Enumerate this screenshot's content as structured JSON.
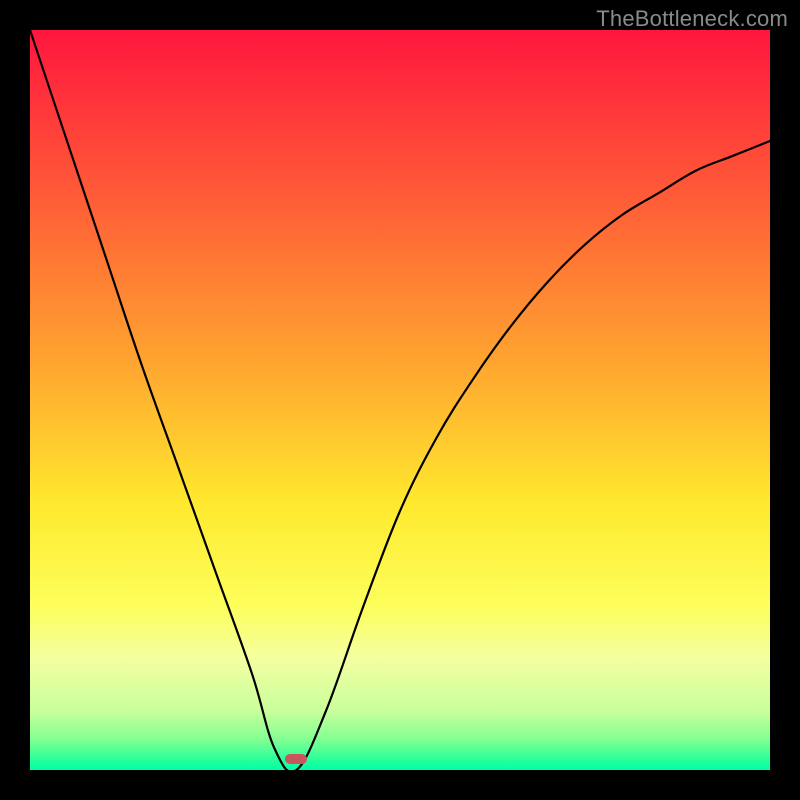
{
  "watermark": "TheBottleneck.com",
  "chart_data": {
    "type": "line",
    "title": "",
    "xlabel": "",
    "ylabel": "",
    "xlim": [
      0,
      100
    ],
    "ylim": [
      0,
      100
    ],
    "grid": false,
    "legend": false,
    "series": [
      {
        "name": "bottleneck-curve",
        "x": [
          0,
          5,
          10,
          15,
          20,
          25,
          30,
          33,
          36,
          40,
          45,
          50,
          55,
          60,
          65,
          70,
          75,
          80,
          85,
          90,
          95,
          100
        ],
        "values": [
          100,
          85,
          70,
          55,
          41,
          27,
          13,
          3,
          0,
          8,
          22,
          35,
          45,
          53,
          60,
          66,
          71,
          75,
          78,
          81,
          83,
          85
        ]
      }
    ],
    "marker": {
      "x": 36,
      "y": 1.5
    },
    "gradient_stops": [
      {
        "pct": 0,
        "color": "#ff163e"
      },
      {
        "pct": 22,
        "color": "#ff5a37"
      },
      {
        "pct": 45,
        "color": "#ffa530"
      },
      {
        "pct": 64,
        "color": "#ffe92e"
      },
      {
        "pct": 78,
        "color": "#fdff5c"
      },
      {
        "pct": 85,
        "color": "#f3ffa1"
      },
      {
        "pct": 92,
        "color": "#c9ff9c"
      },
      {
        "pct": 96,
        "color": "#7fff92"
      },
      {
        "pct": 99,
        "color": "#1bff9b"
      },
      {
        "pct": 100,
        "color": "#00ffb1"
      }
    ]
  }
}
